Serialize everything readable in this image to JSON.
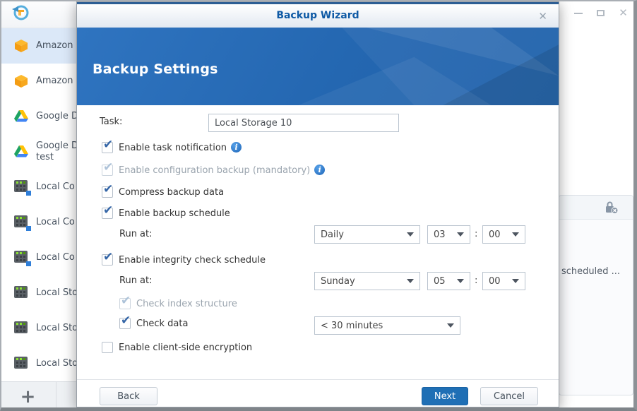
{
  "colors": {
    "accent_blue": "#2368b2",
    "title_text": "#0f5aa5",
    "check_blue": "#3566a7",
    "selected_row": "#dbe8f8",
    "next_button": "#1f6fb5"
  },
  "window": {
    "controls": [
      {
        "name": "minimize"
      },
      {
        "name": "maximize"
      },
      {
        "name": "close",
        "glyph": "✕"
      }
    ]
  },
  "sidebar": {
    "add_button": "+",
    "items": [
      {
        "label": "Amazon",
        "icon": "amazon-cube-icon",
        "selected": true
      },
      {
        "label": "Amazon",
        "icon": "amazon-cube-icon",
        "selected": false
      },
      {
        "label": "Google D",
        "icon": "google-drive-icon",
        "selected": false
      },
      {
        "label": "Google D",
        "label2": "test",
        "icon": "google-drive-icon",
        "selected": false
      },
      {
        "label": "Local Co",
        "icon": "local-server-badge-icon",
        "selected": false
      },
      {
        "label": "Local Co",
        "icon": "local-server-badge-icon",
        "selected": false
      },
      {
        "label": "Local Co",
        "icon": "local-server-badge-icon",
        "selected": false
      },
      {
        "label": "Local Sto",
        "icon": "local-server-icon",
        "selected": false
      },
      {
        "label": "Local Sto",
        "icon": "local-server-icon",
        "selected": false
      },
      {
        "label": "Local Sto",
        "icon": "local-server-icon",
        "selected": false
      }
    ]
  },
  "right_panel": {
    "icon": "lock-remove-icon",
    "snippet": "scheduled ..."
  },
  "dialog": {
    "title": "Backup Wizard",
    "close_glyph": "✕",
    "header_title": "Backup Settings",
    "task_label": "Task:",
    "task_value": "Local Storage 10",
    "check_glyph": "✔",
    "info_glyph": "i",
    "options": {
      "task_notification": "Enable task notification",
      "config_backup": "Enable configuration backup (mandatory)",
      "compress": "Compress backup data",
      "backup_schedule": "Enable backup schedule",
      "backup_run_at_label": "Run at:",
      "backup_run_at": {
        "freq": "Daily",
        "hour": "03",
        "sep": ":",
        "minute": "00"
      },
      "integrity_schedule": "Enable integrity check schedule",
      "integrity_run_at_label": "Run at:",
      "integrity_run_at": {
        "freq": "Sunday",
        "hour": "05",
        "sep": ":",
        "minute": "00"
      },
      "check_index": "Check index structure",
      "check_data": "Check data",
      "check_data_duration": "< 30 minutes",
      "client_encryption": "Enable client-side encryption"
    },
    "buttons": {
      "back": "Back",
      "next": "Next",
      "cancel": "Cancel"
    }
  }
}
